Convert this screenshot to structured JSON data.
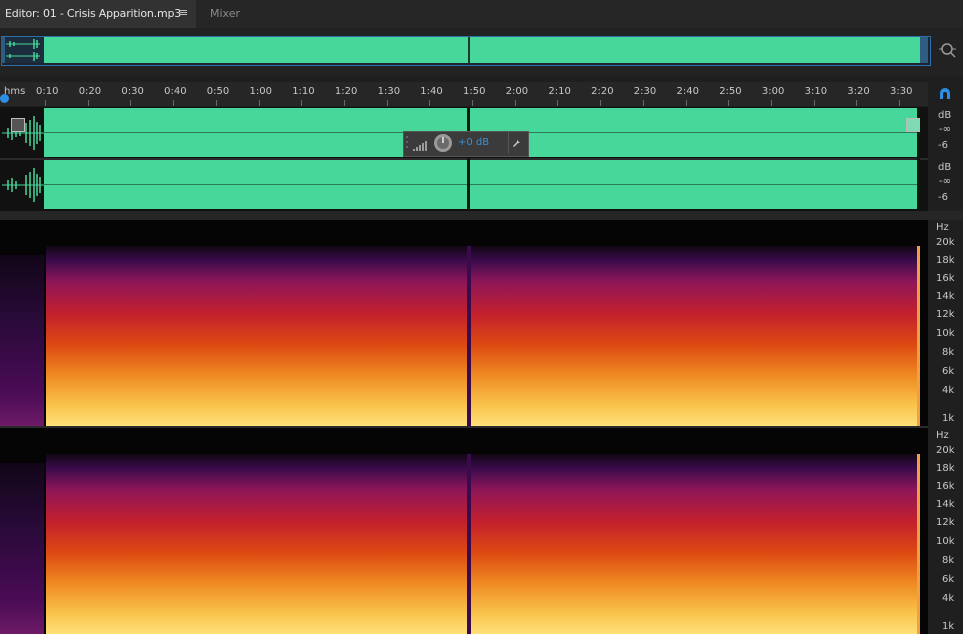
{
  "tabs": {
    "editor_label": "Editor: 01 - Crisis Apparition.mp3",
    "menu_icon": "≡",
    "mixer_label": "Mixer"
  },
  "ruler": {
    "unit": "hms",
    "ticks": [
      "0:10",
      "0:20",
      "0:30",
      "0:40",
      "0:50",
      "1:00",
      "1:10",
      "1:20",
      "1:30",
      "1:40",
      "1:50",
      "2:00",
      "2:10",
      "2:20",
      "2:30",
      "2:40",
      "2:50",
      "3:00",
      "3:10",
      "3:20",
      "3:30"
    ]
  },
  "db_scale": {
    "unit": "dB",
    "inf": "-∞",
    "six": "-6"
  },
  "hud": {
    "value": "+0 dB"
  },
  "hz_scale": {
    "unit": "Hz",
    "labels": [
      "20k",
      "18k",
      "16k",
      "14k",
      "12k",
      "10k",
      "8k",
      "6k",
      "4k",
      "1k"
    ]
  },
  "colors": {
    "waveform": "#47d79a",
    "accent": "#2b8fe5",
    "hud_value": "#3b8fd6"
  }
}
